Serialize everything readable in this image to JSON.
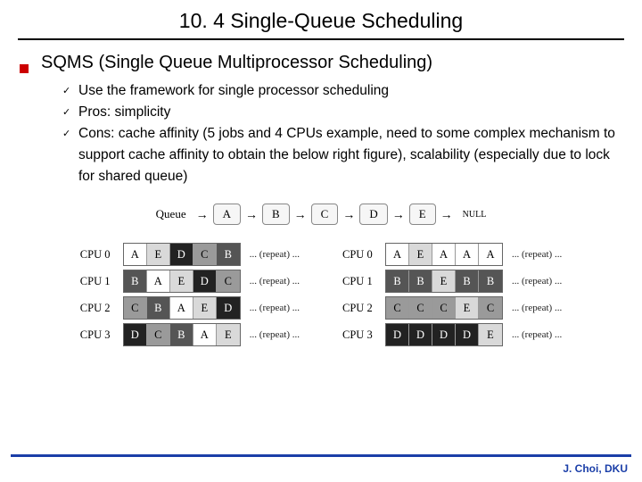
{
  "title": "10. 4 Single-Queue Scheduling",
  "heading": "SQMS (Single Queue Multiprocessor Scheduling)",
  "bullets": [
    "Use the framework for single processor scheduling",
    "Pros: simplicity",
    "Cons: cache affinity (5 jobs and 4 CPUs example, need to some complex mechanism to support cache affinity to obtain the below right figure), scalability (especially due to lock for shared queue)"
  ],
  "queue": {
    "label": "Queue",
    "nodes": [
      "A",
      "B",
      "C",
      "D",
      "E"
    ],
    "end": "NULL"
  },
  "cpu_labels": [
    "CPU 0",
    "CPU 1",
    "CPU 2",
    "CPU 3"
  ],
  "left_table": [
    [
      {
        "t": "A",
        "s": "w"
      },
      {
        "t": "E",
        "s": "l"
      },
      {
        "t": "D",
        "s": "k"
      },
      {
        "t": "C",
        "s": "m"
      },
      {
        "t": "B",
        "s": "d"
      }
    ],
    [
      {
        "t": "B",
        "s": "d"
      },
      {
        "t": "A",
        "s": "w"
      },
      {
        "t": "E",
        "s": "l"
      },
      {
        "t": "D",
        "s": "k"
      },
      {
        "t": "C",
        "s": "m"
      }
    ],
    [
      {
        "t": "C",
        "s": "m"
      },
      {
        "t": "B",
        "s": "d"
      },
      {
        "t": "A",
        "s": "w"
      },
      {
        "t": "E",
        "s": "l"
      },
      {
        "t": "D",
        "s": "k"
      }
    ],
    [
      {
        "t": "D",
        "s": "k"
      },
      {
        "t": "C",
        "s": "m"
      },
      {
        "t": "B",
        "s": "d"
      },
      {
        "t": "A",
        "s": "w"
      },
      {
        "t": "E",
        "s": "l"
      }
    ]
  ],
  "right_table": [
    [
      {
        "t": "A",
        "s": "w"
      },
      {
        "t": "E",
        "s": "l"
      },
      {
        "t": "A",
        "s": "w"
      },
      {
        "t": "A",
        "s": "w"
      },
      {
        "t": "A",
        "s": "w"
      }
    ],
    [
      {
        "t": "B",
        "s": "d"
      },
      {
        "t": "B",
        "s": "d"
      },
      {
        "t": "E",
        "s": "l"
      },
      {
        "t": "B",
        "s": "d"
      },
      {
        "t": "B",
        "s": "d"
      }
    ],
    [
      {
        "t": "C",
        "s": "m"
      },
      {
        "t": "C",
        "s": "m"
      },
      {
        "t": "C",
        "s": "m"
      },
      {
        "t": "E",
        "s": "l"
      },
      {
        "t": "C",
        "s": "m"
      }
    ],
    [
      {
        "t": "D",
        "s": "k"
      },
      {
        "t": "D",
        "s": "k"
      },
      {
        "t": "D",
        "s": "k"
      },
      {
        "t": "D",
        "s": "k"
      },
      {
        "t": "E",
        "s": "l"
      }
    ]
  ],
  "repeat": "... (repeat) ...",
  "footer": "J. Choi, DKU"
}
